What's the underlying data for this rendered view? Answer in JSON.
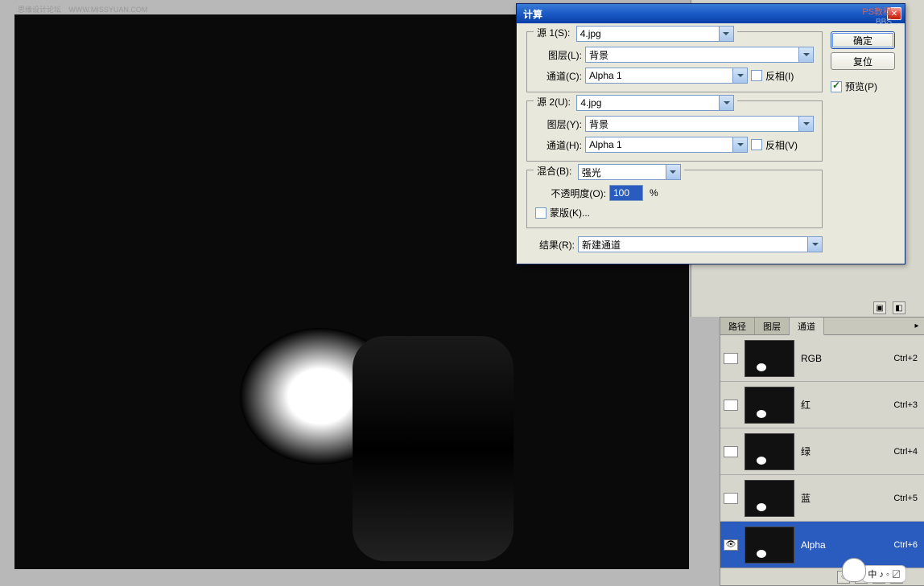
{
  "watermark": {
    "left_main": "思缘设计论坛",
    "left_sub": "WWW.MISSYUAN.COM",
    "right_main": "PS教程",
    "right_sub": "BBS"
  },
  "dialog": {
    "title": "计算",
    "source1_group": "源 1(S):",
    "source2_group": "源 2(U):",
    "layer_label1": "图层(L):",
    "layer_label2": "图层(Y):",
    "channel_label1": "通道(C):",
    "channel_label2": "通道(H):",
    "source1_value": "4.jpg",
    "source2_value": "4.jpg",
    "layer1_value": "背景",
    "layer2_value": "背景",
    "channel1_value": "Alpha 1",
    "channel2_value": "Alpha 1",
    "invert1": "反相(I)",
    "invert2": "反相(V)",
    "blend_group": "混合(B):",
    "blend_value": "强光",
    "opacity_label": "不透明度(O):",
    "opacity_value": "100",
    "opacity_pct": "%",
    "mask_label": "蒙版(K)...",
    "result_label": "结果(R):",
    "result_value": "新建通道",
    "ok": "确定",
    "reset": "复位",
    "preview": "预览(P)"
  },
  "channels": {
    "tab_paths": "路径",
    "tab_layers": "图层",
    "tab_channels": "通道",
    "items": [
      {
        "name": "RGB",
        "shortcut": "Ctrl+2",
        "eye": false,
        "sel": false
      },
      {
        "name": "红",
        "shortcut": "Ctrl+3",
        "eye": false,
        "sel": false
      },
      {
        "name": "绿",
        "shortcut": "Ctrl+4",
        "eye": false,
        "sel": false
      },
      {
        "name": "蓝",
        "shortcut": "Ctrl+5",
        "eye": false,
        "sel": false
      },
      {
        "name": "Alpha",
        "shortcut": "Ctrl+6",
        "eye": true,
        "sel": true
      }
    ]
  },
  "ime": {
    "text": "中 ♪ ◦ 〼 "
  }
}
